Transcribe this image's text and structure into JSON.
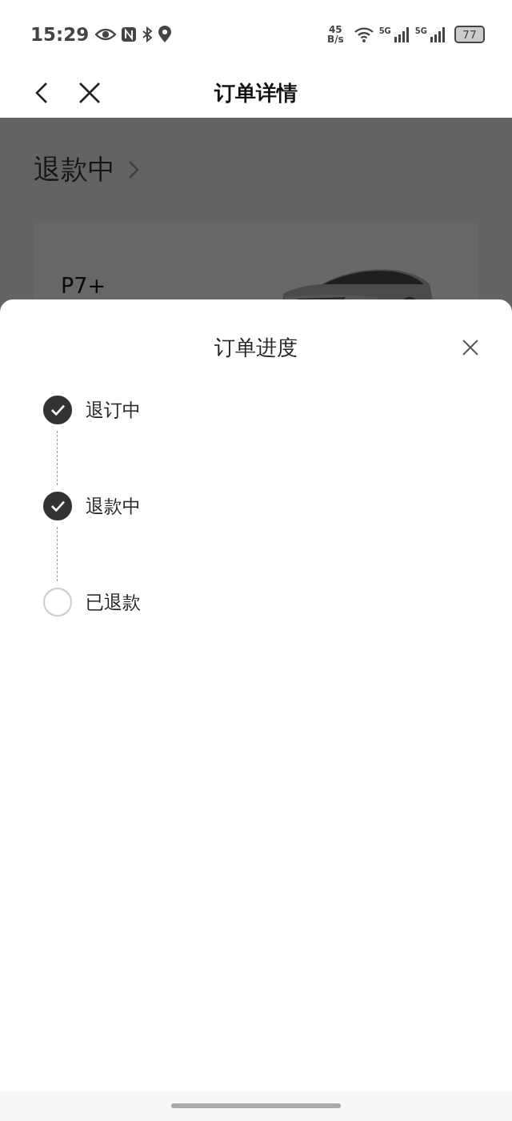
{
  "status_bar": {
    "time": "15:29",
    "net_speed": "45",
    "net_unit": "B/s",
    "signals": [
      "5G",
      "5G"
    ],
    "battery": "77"
  },
  "header": {
    "title": "订单详情"
  },
  "background": {
    "status": "退款中",
    "card": {
      "model": "P7+"
    }
  },
  "sheet": {
    "title": "订单进度",
    "steps": [
      {
        "label": "退订中",
        "checked": true
      },
      {
        "label": "退款中",
        "checked": true
      },
      {
        "label": "已退款",
        "checked": false
      }
    ]
  }
}
